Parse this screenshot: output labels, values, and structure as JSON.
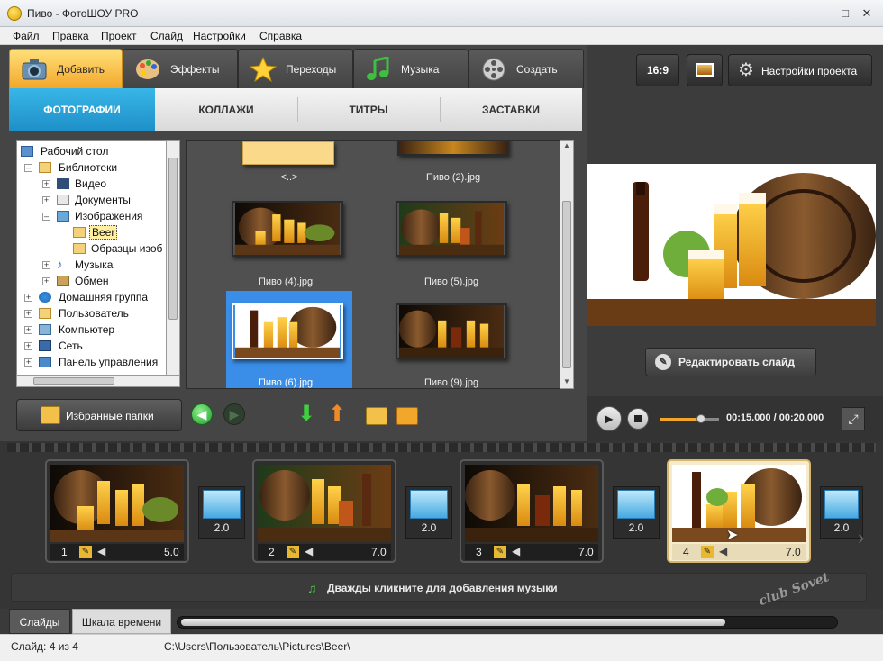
{
  "window": {
    "title": "Пиво - ФотоШОУ PRO"
  },
  "menu": [
    "Файл",
    "Правка",
    "Проект",
    "Слайд",
    "Настройки",
    "Справка"
  ],
  "tabs": [
    {
      "label": "Добавить",
      "icon": "camera-icon"
    },
    {
      "label": "Эффекты",
      "icon": "palette-icon"
    },
    {
      "label": "Переходы",
      "icon": "star-icon"
    },
    {
      "label": "Музыка",
      "icon": "music-note-icon"
    },
    {
      "label": "Создать",
      "icon": "film-reel-icon"
    }
  ],
  "subtabs": [
    "ФОТОГРАФИИ",
    "КОЛЛАЖИ",
    "ТИТРЫ",
    "ЗАСТАВКИ"
  ],
  "tree": [
    {
      "label": "Рабочий стол",
      "icon": "desktop-icon"
    },
    {
      "label": "Библиотеки",
      "icon": "library-icon"
    },
    {
      "label": "Видео",
      "icon": "video-icon"
    },
    {
      "label": "Документы",
      "icon": "documents-icon"
    },
    {
      "label": "Изображения",
      "icon": "pictures-icon"
    },
    {
      "label": "Beer",
      "icon": "folder-icon"
    },
    {
      "label": "Образцы изоб",
      "icon": "folder-icon"
    },
    {
      "label": "Музыка",
      "icon": "music-icon"
    },
    {
      "label": "Обмен",
      "icon": "share-icon"
    },
    {
      "label": "Домашняя группа",
      "icon": "homegroup-icon"
    },
    {
      "label": "Пользователь",
      "icon": "user-icon"
    },
    {
      "label": "Компьютер",
      "icon": "computer-icon"
    },
    {
      "label": "Сеть",
      "icon": "network-icon"
    },
    {
      "label": "Панель управления",
      "icon": "control-panel-icon"
    }
  ],
  "files": [
    {
      "label": "<..>"
    },
    {
      "label": "Пиво (2).jpg"
    },
    {
      "label": "Пиво (4).jpg"
    },
    {
      "label": "Пиво (5).jpg"
    },
    {
      "label": "Пиво (6).jpg"
    },
    {
      "label": "Пиво (9).jpg"
    }
  ],
  "favorites_button": "Избранные папки",
  "right": {
    "ratio": "16:9",
    "settings_button": "Настройки проекта",
    "edit_slide_button": "Редактировать слайд",
    "time": "00:15.000 / 00:20.000",
    "volume": 0.7
  },
  "slides": [
    {
      "num": "1",
      "dur": "5.0"
    },
    {
      "num": "2",
      "dur": "7.0"
    },
    {
      "num": "3",
      "dur": "7.0"
    },
    {
      "num": "4",
      "dur": "7.0"
    }
  ],
  "transitions": [
    "2.0",
    "2.0",
    "2.0",
    "2.0"
  ],
  "music_hint": "Дважды кликните для добавления музыки",
  "bottom_tabs": [
    "Слайды",
    "Шкала времени"
  ],
  "status": {
    "slide": "Слайд: 4 из 4",
    "path": "C:\\Users\\Пользователь\\Pictures\\Beer\\"
  },
  "watermark": "club Sovet",
  "colors": {
    "accent_orange": "#f3a72a",
    "accent_blue": "#1e8fc8",
    "selection": "#3a8ee8"
  }
}
